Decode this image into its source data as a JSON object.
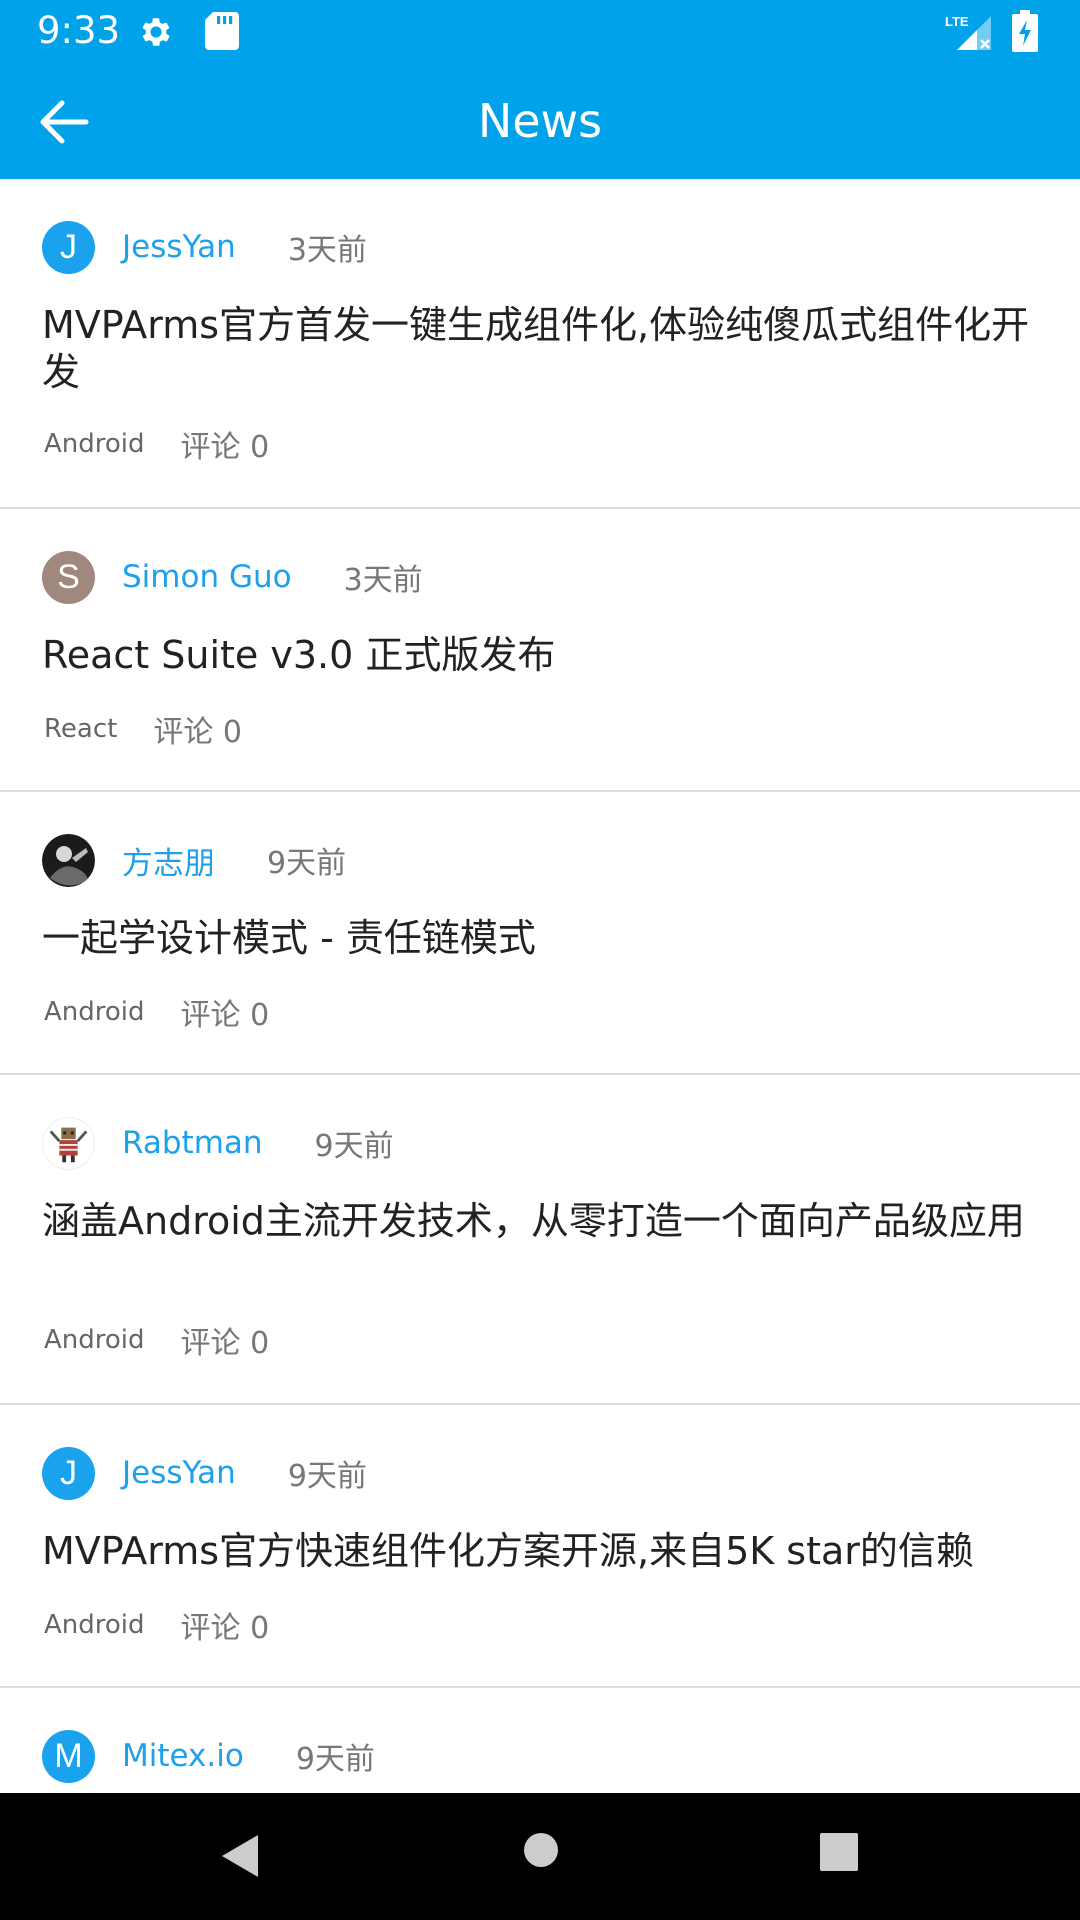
{
  "status_bar": {
    "time": "9:33",
    "icons": [
      "gear-icon",
      "sd-card-icon",
      "lte-signal-icon",
      "battery-charging-icon"
    ],
    "lte_label": "LTE"
  },
  "toolbar": {
    "title": "News",
    "back_icon": "arrow-left-icon",
    "accent_color": "#00a2ea"
  },
  "news": [
    {
      "avatar_letter": "J",
      "avatar_color": "#1aa3ec",
      "author": "JessYan",
      "time": "3天前",
      "title": "MVPArms官方首发一键生成组件化,体验纯傻瓜式组件化开发",
      "tag": "Android",
      "comments": "评论 0"
    },
    {
      "avatar_letter": "S",
      "avatar_color": "#a1887f",
      "author": "Simon Guo",
      "time": "3天前",
      "title": "React Suite v3.0 正式版发布",
      "tag": "React",
      "comments": "评论 0"
    },
    {
      "avatar_letter": "",
      "avatar_color": "#222222",
      "author": "方志朋",
      "time": "9天前",
      "title": "一起学设计模式 - 责任链模式",
      "tag": "Android",
      "comments": "评论 0"
    },
    {
      "avatar_letter": "",
      "avatar_color": "#ffffff",
      "author": "Rabtman",
      "time": "9天前",
      "title": "涵盖Android主流开发技术，从零打造一个面向产品级应用",
      "tag": "Android",
      "comments": "评论 0"
    },
    {
      "avatar_letter": "J",
      "avatar_color": "#1aa3ec",
      "author": "JessYan",
      "time": "9天前",
      "title": "MVPArms官方快速组件化方案开源,来自5K star的信赖",
      "tag": "Android",
      "comments": "评论 0"
    },
    {
      "avatar_letter": "M",
      "avatar_color": "#1aa3ec",
      "author": "Mitex.io",
      "time": "9天前",
      "title": "",
      "tag": "",
      "comments": ""
    }
  ],
  "nav_bar": {
    "icons": [
      "back-triangle-icon",
      "home-circle-icon",
      "recents-square-icon"
    ]
  }
}
